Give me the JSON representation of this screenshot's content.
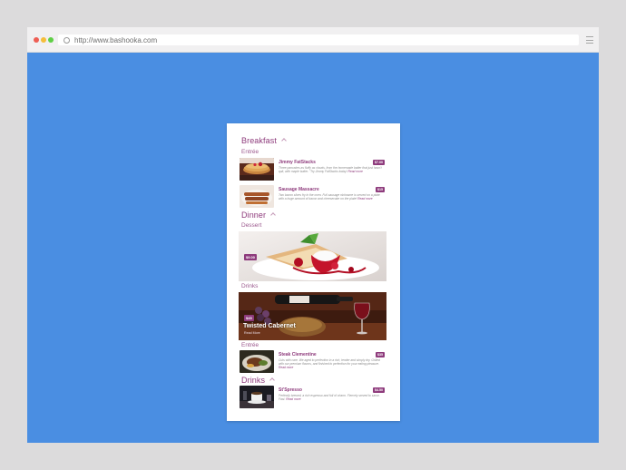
{
  "browser": {
    "url": "http://www.bashooka.com"
  },
  "menu": {
    "breakfast": {
      "title": "Breakfast",
      "subsection": "Entrée",
      "items": [
        {
          "name": "Jimmy FatStacks",
          "price": "$7.00",
          "desc": "Three pancakes as fluffy as clouds, from the homemade batter that just hasn't quit, with maple butter. \"Try Jimmy FatStacks today!",
          "read_more": "Read more"
        },
        {
          "name": "Sausage Massacre",
          "price": "$15",
          "desc": "Two bacon slices fry in the oven. Full sausage nickname is served on a plate with a huge amount of bacon and cheesecake on the plate!",
          "read_more": "Read more"
        }
      ]
    },
    "dinner": {
      "title": "Dinner",
      "dessert_label": "Dessert",
      "dessert_price": "$9.00",
      "drinks_label": "Drinks",
      "drink_banner": {
        "price": "$45",
        "title": "Twisted Cabernet",
        "subtitle": "Read More"
      },
      "entree_label": "Entrée",
      "items": [
        {
          "name": "Steak Clementine",
          "price": "$35",
          "desc": "Cuts with care. We aged to perfection in a rich, tender and simply dry. Grilled with our premium flavors, and finished to perfection for your eating pleasure.",
          "read_more": "Read more"
        }
      ]
    },
    "drinks": {
      "title": "Drinks",
      "items": [
        {
          "name": "St'Spresso",
          "price": "$4.50",
          "desc": "Perfectly brewed, a rich espresso and full of charm. Fiercely served to savor. Fast.",
          "read_more": "Read more"
        }
      ]
    }
  },
  "colors": {
    "accent": "#8e3b7c",
    "background": "#4a8ee2"
  }
}
